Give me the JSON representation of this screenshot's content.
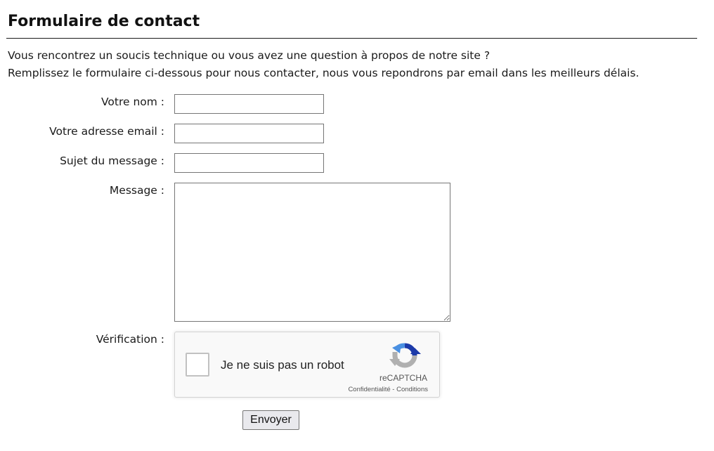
{
  "page": {
    "title": "Formulaire de contact",
    "intro_line1": "Vous rencontrez un soucis technique ou vous avez une question à propos de notre site ?",
    "intro_line2": "Remplissez le formulaire ci-dessous pour nous contacter, nous vous repondrons par email dans les meilleurs délais."
  },
  "form": {
    "name_label": "Votre nom :",
    "name_value": "",
    "email_label": "Votre adresse email :",
    "email_value": "",
    "subject_label": "Sujet du message :",
    "subject_value": "",
    "message_label": "Message :",
    "message_value": "",
    "verification_label": "Vérification :",
    "submit_label": "Envoyer"
  },
  "captcha": {
    "checkbox_label": "Je ne suis pas un robot",
    "brand": "reCAPTCHA",
    "privacy_link": "Confidentialité",
    "separator": " - ",
    "terms_link": "Conditions",
    "checked": false,
    "logo_icon": "recaptcha-logo-icon",
    "colors": {
      "blue_dark": "#1c3aa9",
      "blue": "#4a90e2",
      "gray": "#b0b0b0"
    }
  }
}
